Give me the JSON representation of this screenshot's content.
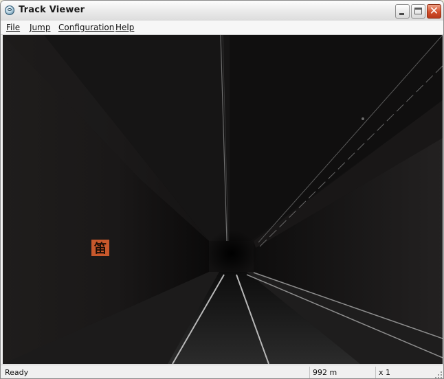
{
  "window": {
    "title": "Track Viewer",
    "icon": "track-viewer-app-icon",
    "controls": {
      "minimize": "_",
      "maximize": "□",
      "close": "✕"
    }
  },
  "menu": {
    "items": [
      {
        "label": "File"
      },
      {
        "label": "Jump"
      },
      {
        "label": "Configuration"
      },
      {
        "label": "Help"
      }
    ]
  },
  "scene": {
    "description_colors": {
      "tunnel": "#1a1818",
      "rail": "#bdbdbd",
      "sign": "#c8582c"
    },
    "sign_glyph": "笛"
  },
  "status": {
    "message": "Ready",
    "distance": "992 m",
    "speed_multiplier": "x 1"
  }
}
